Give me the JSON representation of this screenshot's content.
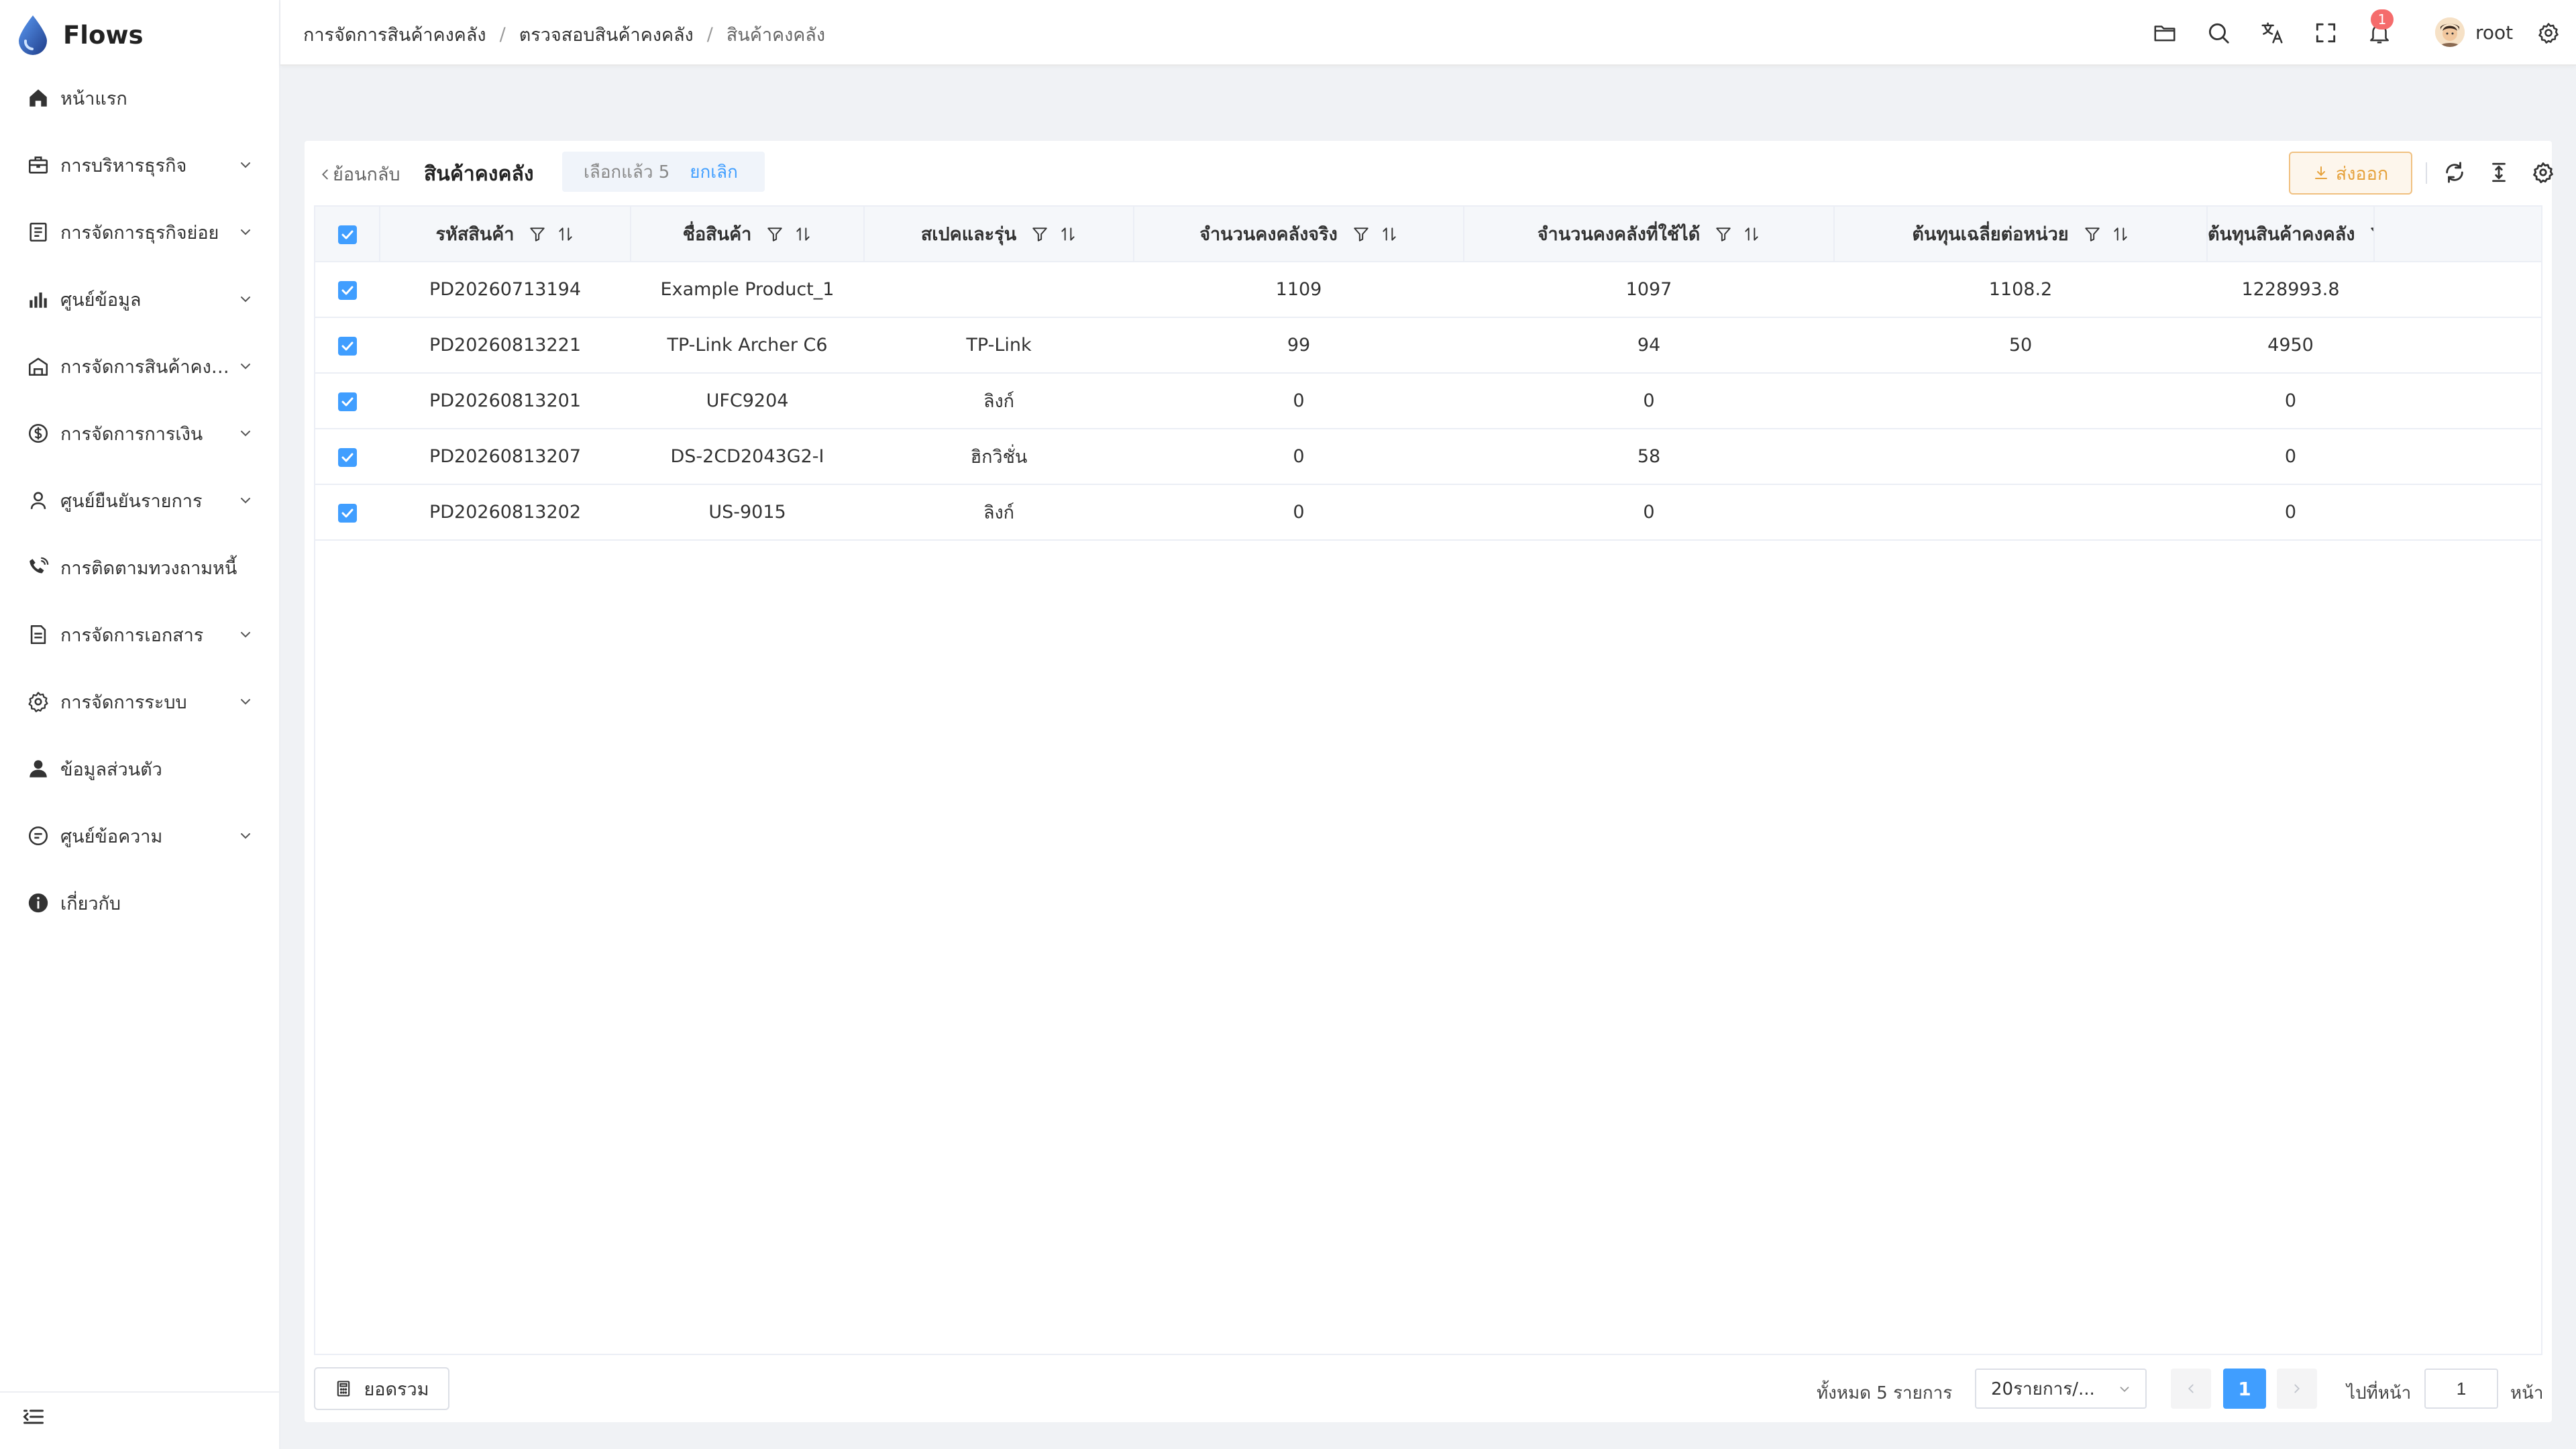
{
  "app": {
    "name": "Flows"
  },
  "sidebar": {
    "items": [
      {
        "label": "หน้าแรก",
        "icon": "home-icon",
        "has_children": false
      },
      {
        "label": "การบริหารธุรกิจ",
        "icon": "briefcase-icon",
        "has_children": true
      },
      {
        "label": "การจัดการธุรกิจย่อย",
        "icon": "document-icon",
        "has_children": true
      },
      {
        "label": "ศูนย์ข้อมูล",
        "icon": "bar-chart-icon",
        "has_children": true
      },
      {
        "label": "การจัดการสินค้าคงคลัง",
        "icon": "warehouse-icon",
        "has_children": true
      },
      {
        "label": "การจัดการการเงิน",
        "icon": "dollar-circle-icon",
        "has_children": true
      },
      {
        "label": "ศูนย์ยืนยันรายการ",
        "icon": "user-check-icon",
        "has_children": true
      },
      {
        "label": "การติดตามทวงถามหนี้",
        "icon": "phone-icon",
        "has_children": false
      },
      {
        "label": "การจัดการเอกสาร",
        "icon": "file-icon",
        "has_children": true
      },
      {
        "label": "การจัดการระบบ",
        "icon": "gear-icon",
        "has_children": true
      },
      {
        "label": "ข้อมูลส่วนตัว",
        "icon": "user-icon",
        "has_children": false
      },
      {
        "label": "ศูนย์ข้อความ",
        "icon": "chat-icon",
        "has_children": true
      },
      {
        "label": "เกี่ยวกับ",
        "icon": "info-icon",
        "has_children": false
      }
    ]
  },
  "header": {
    "breadcrumb": [
      "การจัดการสินค้าคงคลัง",
      "ตรวจสอบสินค้าคงคลัง",
      "สินค้าคงคลัง"
    ],
    "notification_count": "1",
    "user_name": "root"
  },
  "toolbar": {
    "back_label": "ย้อนกลับ",
    "title": "สินค้าคงคลัง",
    "selected_label": "เลือกแล้ว 5",
    "cancel_label": "ยกเลิก",
    "export_label": "ส่งออก"
  },
  "table": {
    "columns": [
      "รหัสสินค้า",
      "ชื่อสินค้า",
      "สเปคและรุ่น",
      "จำนวนคงคลังจริง",
      "จำนวนคงคลังที่ใช้ได้",
      "ต้นทุนเฉลี่ยต่อหน่วย",
      "ต้นทุนสินค้าคงคลัง"
    ],
    "rows": [
      [
        "PD20260713194",
        "Example Product_1",
        "",
        "1109",
        "1097",
        "1108.2",
        "1228993.8"
      ],
      [
        "PD20260813221",
        "TP-Link Archer C6",
        "TP-Link",
        "99",
        "94",
        "50",
        "4950"
      ],
      [
        "PD20260813201",
        "UFC9204",
        "ลิงก์",
        "0",
        "0",
        "",
        "0"
      ],
      [
        "PD20260813207",
        "DS-2CD2043G2-I",
        "ฮิกวิชั่น",
        "0",
        "58",
        "",
        "0"
      ],
      [
        "PD20260813202",
        "US-9015",
        "ลิงก์",
        "0",
        "0",
        "",
        "0"
      ]
    ]
  },
  "footer": {
    "summary_label": "ยอดรวม",
    "total_text": "ทั้งหมด 5 รายการ",
    "page_size": "20รายการ/...",
    "current_page": "1",
    "goto_label": "ไปที่หน้า",
    "goto_value": "1",
    "goto_suffix": "หน้า"
  },
  "colors": {
    "primary": "#409eff",
    "export": "#e6a23c",
    "badge": "#f56c6c"
  }
}
